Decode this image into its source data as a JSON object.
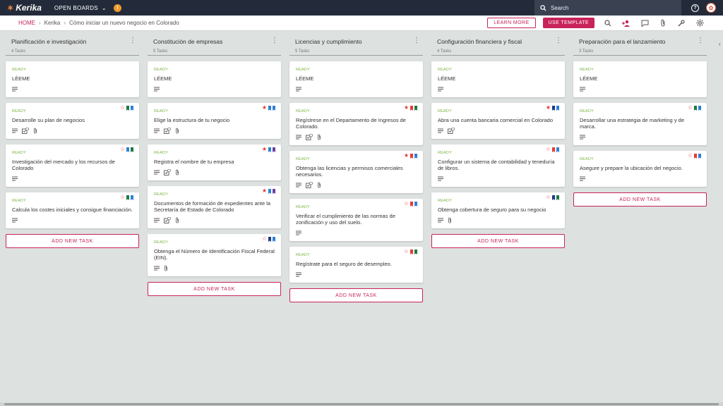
{
  "app": {
    "logo": "Kerika",
    "open_boards": "OPEN BOARDS",
    "notif_count": "!"
  },
  "search": {
    "placeholder": "Search"
  },
  "breadcrumb": {
    "home": "HOME",
    "org": "Kerika",
    "board": "Cómo iniciar un nuevo negocio en Colorado"
  },
  "buttons": {
    "learn_more": "LEARN MORE",
    "use_template": "USE TEMPLATE",
    "add_task": "ADD NEW TASK"
  },
  "colors": {
    "accent": "#c8235a",
    "red": "#e53935",
    "green": "#1b7a3e",
    "blue": "#2f7fd6",
    "navy": "#1a3a8a",
    "purple": "#6a3fa0",
    "ready": "#7cb342"
  },
  "columns": [
    {
      "title": "Planificación e investigación",
      "count": "4 Tasks",
      "cards": [
        {
          "status": "READY",
          "title": "LÉEME",
          "star": "",
          "flags": [],
          "icons": [
            "desc"
          ]
        },
        {
          "status": "READY",
          "title": "Desarrolle su plan de negocios",
          "star": "outline",
          "flags": [
            "green",
            "blue"
          ],
          "icons": [
            "desc",
            "check",
            "clip"
          ]
        },
        {
          "status": "READY",
          "title": "Investigación del mercado y los recursos de Colorado",
          "star": "outline",
          "flags": [
            "blue",
            "green"
          ],
          "icons": [
            "desc"
          ]
        },
        {
          "status": "READY",
          "title": "Calcula los costes iniciales y consigue financiación.",
          "star": "outline",
          "flags": [
            "green",
            "blue"
          ],
          "icons": [
            "desc"
          ]
        }
      ]
    },
    {
      "title": "Constitución de empresas",
      "count": "5 Tasks",
      "cards": [
        {
          "status": "READY",
          "title": "LÉEME",
          "star": "",
          "flags": [],
          "icons": [
            "desc"
          ]
        },
        {
          "status": "READY",
          "title": "Elige la estructura de tu negocio",
          "star": "filled",
          "flags": [
            "blue",
            "blue"
          ],
          "icons": [
            "desc",
            "check",
            "clip"
          ]
        },
        {
          "status": "READY",
          "title": "Registra el nombre de tu empresa",
          "star": "filled",
          "flags": [
            "blue",
            "purple"
          ],
          "icons": [
            "desc",
            "check",
            "clip"
          ]
        },
        {
          "status": "READY",
          "title": "Documentos de formación de expedientes ante la Secretaría de Estado de Colorado",
          "star": "filled",
          "flags": [
            "blue",
            "purple"
          ],
          "icons": [
            "desc",
            "check",
            "clip"
          ]
        },
        {
          "status": "READY",
          "title": "Obtenga el Número de Identificación Fiscal Federal (EIN).",
          "star": "outline",
          "flags": [
            "navy",
            "blue"
          ],
          "icons": [
            "desc",
            "clip"
          ]
        }
      ]
    },
    {
      "title": "Licencias y cumplimiento",
      "count": "5 Tasks",
      "cards": [
        {
          "status": "READY",
          "title": "LÉEME",
          "star": "",
          "flags": [],
          "icons": [
            "desc"
          ]
        },
        {
          "status": "READY",
          "title": "Regístrese en el Departamento de Ingresos de Colorado.",
          "star": "filled",
          "flags": [
            "red",
            "green"
          ],
          "icons": [
            "desc",
            "check",
            "clip"
          ]
        },
        {
          "status": "READY",
          "title": "Obtenga las licencias y permisos comerciales necesarios.",
          "star": "filled",
          "flags": [
            "red",
            "blue"
          ],
          "icons": [
            "desc",
            "check",
            "clip"
          ]
        },
        {
          "status": "READY",
          "title": "Verificar el cumplimiento de las normas de zonificación y uso del suelo.",
          "star": "outline",
          "flags": [
            "red",
            "blue"
          ],
          "icons": [
            "desc"
          ]
        },
        {
          "status": "READY",
          "title": "Regístrate para el seguro de desempleo.",
          "star": "outline",
          "flags": [
            "red",
            "green"
          ],
          "icons": [
            "desc"
          ]
        }
      ]
    },
    {
      "title": "Configuración financiera y fiscal",
      "count": "4 Tasks",
      "cards": [
        {
          "status": "READY",
          "title": "LÉEME",
          "star": "",
          "flags": [],
          "icons": [
            "desc"
          ]
        },
        {
          "status": "READY",
          "title": "Abra una cuenta bancaria comercial en Colorado",
          "star": "filled",
          "flags": [
            "navy",
            "blue"
          ],
          "icons": [
            "desc",
            "check"
          ]
        },
        {
          "status": "READY",
          "title": "Configurar un sistema de contabilidad y teneduría de libros.",
          "star": "outline",
          "flags": [
            "red",
            "blue"
          ],
          "icons": [
            "desc"
          ]
        },
        {
          "status": "READY",
          "title": "Obtenga cobertura de seguro para su negocio",
          "star": "outline",
          "flags": [
            "navy",
            "green"
          ],
          "icons": [
            "desc",
            "clip"
          ]
        }
      ]
    },
    {
      "title": "Preparación para el lanzamiento",
      "count": "3 Tasks",
      "cards": [
        {
          "status": "READY",
          "title": "LÉEME",
          "star": "",
          "flags": [],
          "icons": [
            "desc"
          ]
        },
        {
          "status": "READY",
          "title": "Desarrollar una estrategia de marketing y de marca.",
          "star": "outline",
          "flags": [
            "green",
            "blue"
          ],
          "icons": [
            "desc"
          ]
        },
        {
          "status": "READY",
          "title": "Asegure y prepare la ubicación del negocio.",
          "star": "outline",
          "flags": [
            "red",
            "blue"
          ],
          "icons": [
            "desc"
          ]
        }
      ]
    }
  ]
}
